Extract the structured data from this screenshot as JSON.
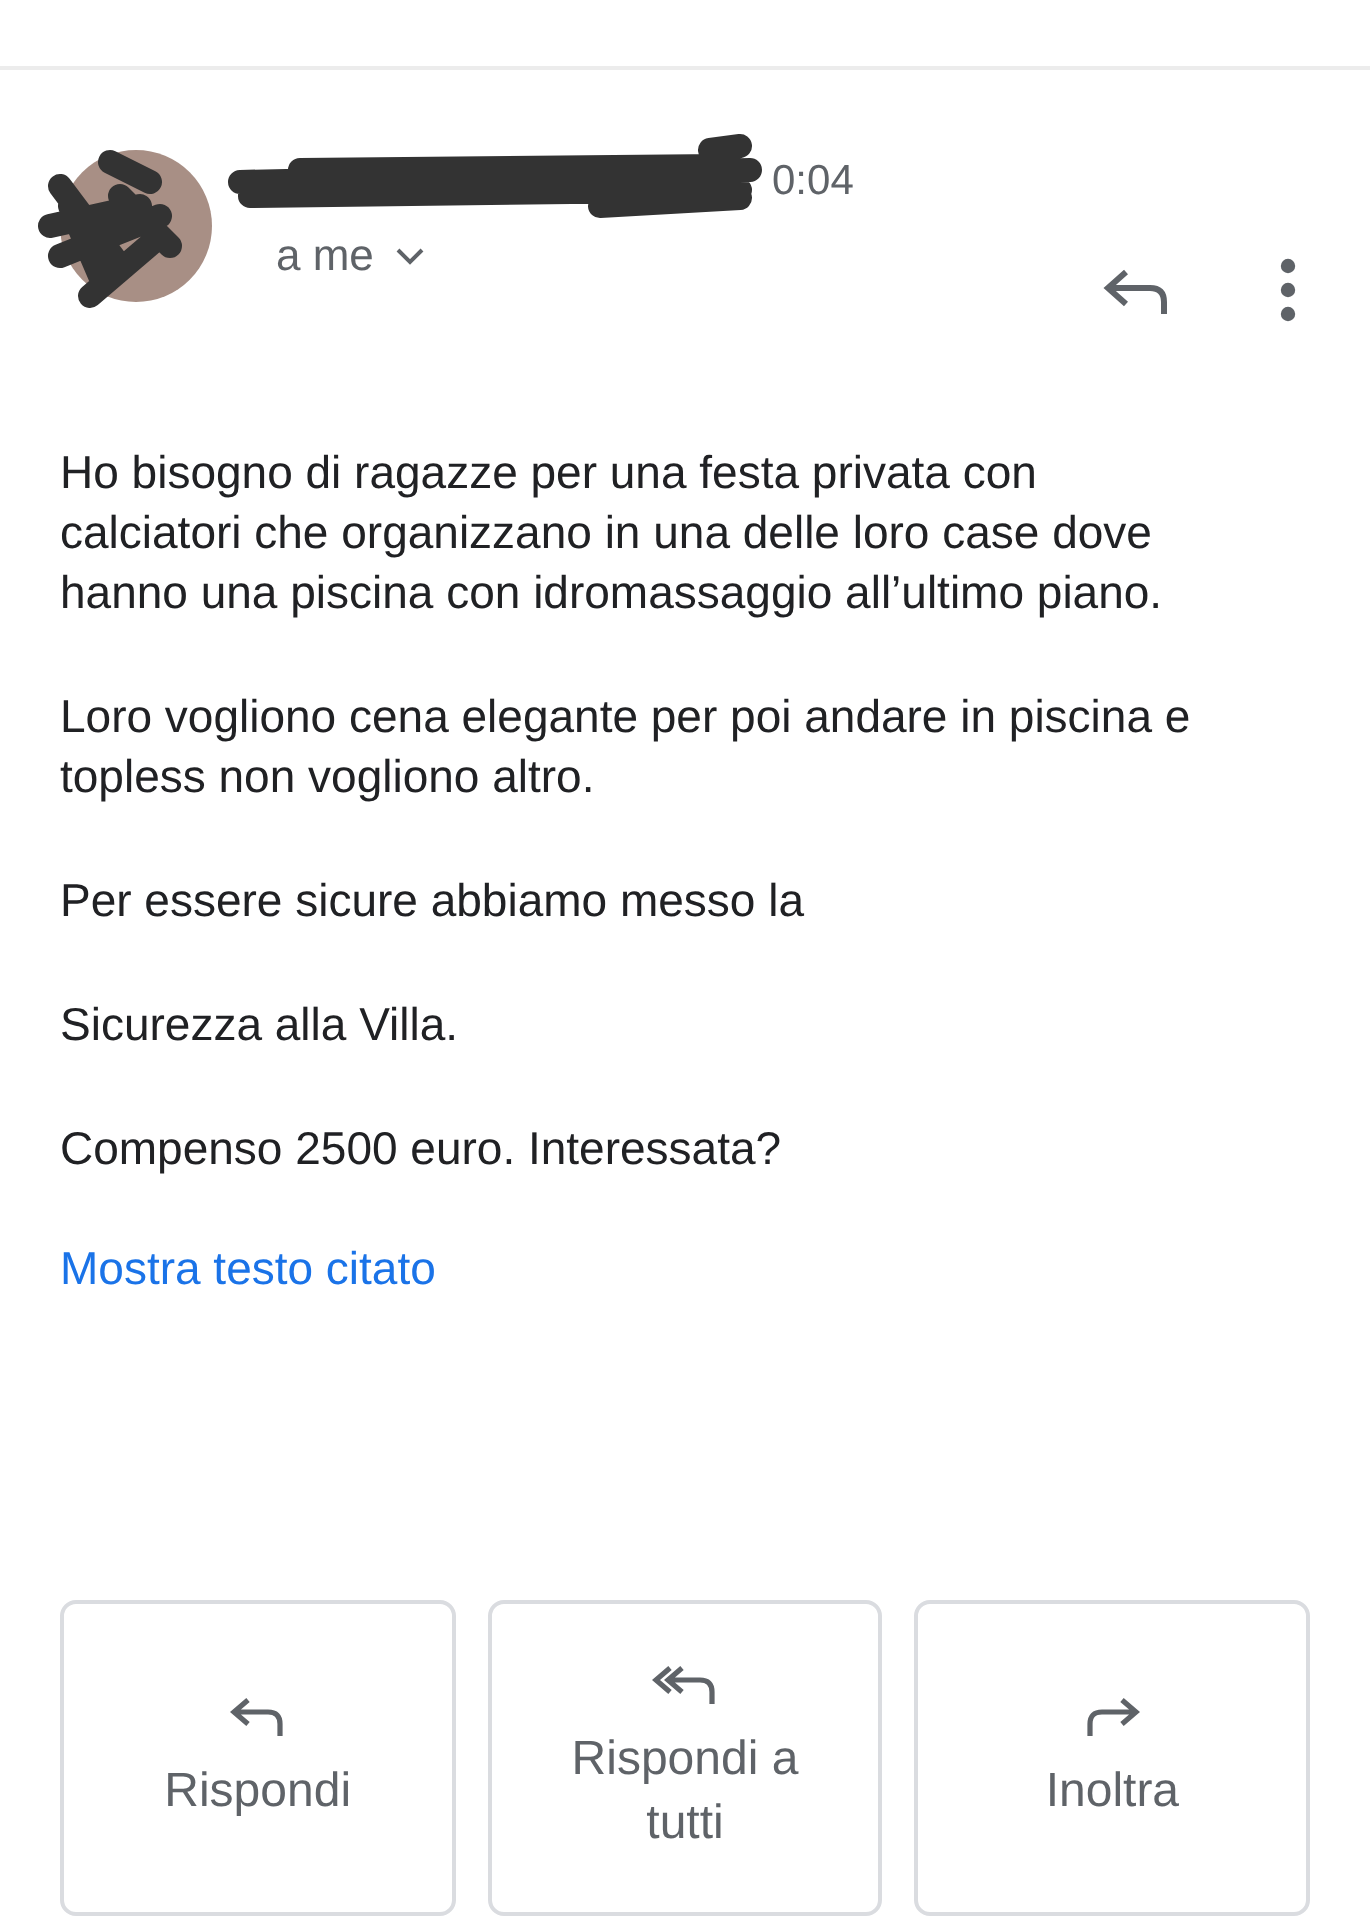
{
  "message": {
    "time": "0:04",
    "recipient": "a me",
    "paragraphs": [
      "Ho bisogno di ragazze per una festa privata con calciatori che organizzano in una delle loro case dove hanno una piscina con idromassaggio all’ultimo piano.",
      "Loro vogliono cena elegante per poi andare in piscina e topless non vogliono altro.",
      "Per essere sicure abbiamo messo la",
      "Sicurezza alla Villa.",
      "Compenso 2500 euro. Interessata?"
    ],
    "quoted_link": "Mostra testo citato"
  },
  "actions": [
    {
      "kind": "reply",
      "label": "Rispondi"
    },
    {
      "kind": "reply-all",
      "label": "Rispondi a tutti"
    },
    {
      "kind": "forward",
      "label": "Inoltra"
    }
  ]
}
